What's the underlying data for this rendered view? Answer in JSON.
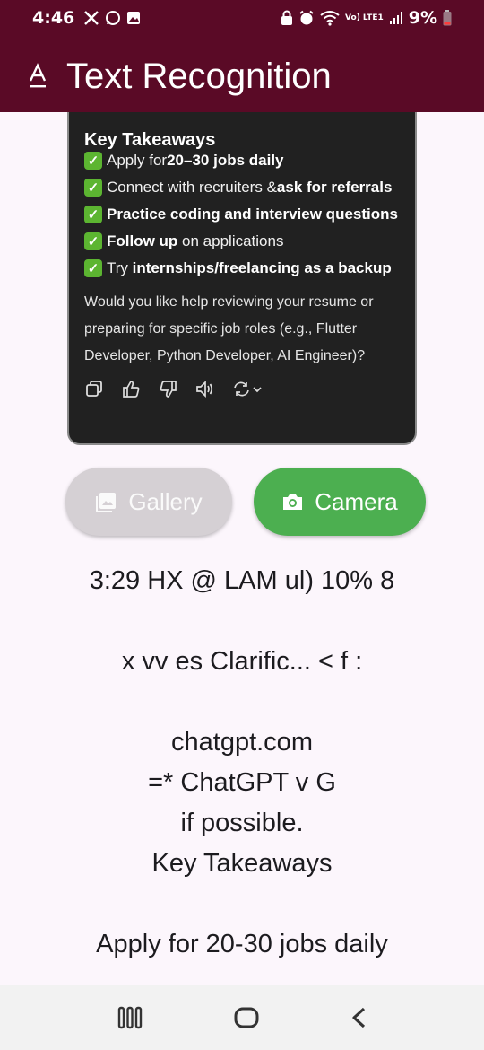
{
  "status_bar": {
    "time": "4:46",
    "network_label": "Vo) LTE1",
    "battery": "9%"
  },
  "app_bar": {
    "title": "Text Recognition",
    "icon": "text-a-icon"
  },
  "screenshot_card": {
    "heading": "Key Takeaways",
    "bullets": [
      {
        "pre": "Apply for ",
        "bold": "20–30 jobs daily",
        "post": ""
      },
      {
        "pre": "Connect with recruiters & ",
        "bold": "ask for referrals",
        "post": ""
      },
      {
        "pre": "",
        "bold": "Practice coding and interview questions",
        "post": ""
      },
      {
        "pre": "",
        "bold": "Follow up",
        "post": " on applications"
      },
      {
        "pre": "Try ",
        "bold": "internships/freelancing as a backup",
        "post": ""
      }
    ],
    "paragraph": "Would you like help reviewing your resume or preparing for specific job roles (e.g., Flutter Developer, Python Developer, AI Engineer)?",
    "actions": [
      "copy-icon",
      "thumbs-up-icon",
      "thumbs-down-icon",
      "speaker-icon",
      "regenerate-icon"
    ]
  },
  "buttons": {
    "gallery": "Gallery",
    "camera": "Camera"
  },
  "recognized_text": {
    "lines": [
      "3:29 HX @ LAM ul) 10% 8",
      "",
      "x vv es Clarific... < f :",
      "",
      "chatgpt.com",
      "=* ChatGPT v G",
      "if possible.",
      "Key Takeaways",
      "",
      "Apply for 20-30 jobs daily"
    ]
  },
  "colors": {
    "app_bar": "#5a0a26",
    "camera_button": "#4caf50",
    "gallery_button": "#d5d0d4",
    "background": "#fcf6fc"
  }
}
